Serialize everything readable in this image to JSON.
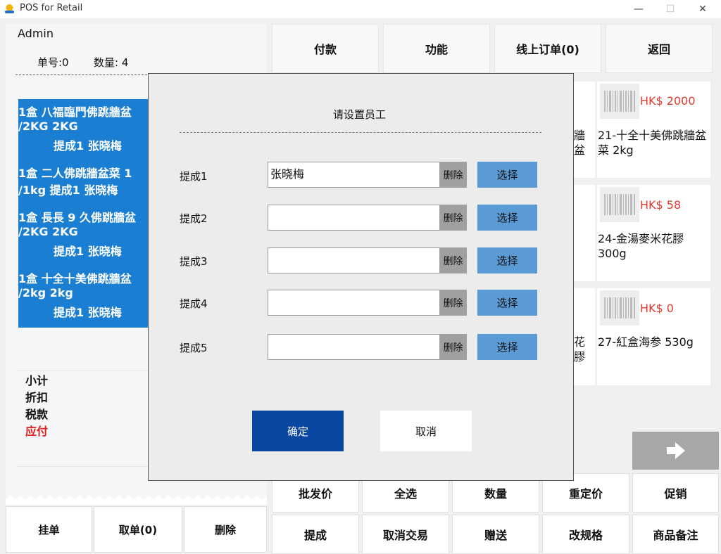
{
  "window": {
    "title": "POS for Retail",
    "minimize": "—",
    "maximize": "☐",
    "close": "✕"
  },
  "left": {
    "user": "Admin",
    "order_no": "单号:0",
    "quantity": "数量: 4",
    "items": [
      {
        "l1": "1盒    八福臨門佛跳牆盆",
        "l2": "/2KG  2KG",
        "l3": "提成1  张晓梅"
      },
      {
        "l1": "1盒    二人佛跳牆盆菜 1",
        "l2": "/1kg  提成1  张晓梅"
      },
      {
        "l1": "1盒    長長 9 久佛跳牆盆",
        "l2": "/2KG  2KG",
        "l3": "提成1  张晓梅"
      },
      {
        "l1": "1盒    十全十美佛跳牆盆",
        "l2": "/2kg  2kg",
        "l3": "提成1  张晓梅"
      }
    ],
    "summary": {
      "subtotal": "小计",
      "discount": "折扣",
      "tax": "税款",
      "payable": "应付"
    },
    "bottom_buttons": [
      "挂单",
      "取单(0)",
      "删除"
    ]
  },
  "top_buttons": [
    "付款",
    "功能",
    "线上订单(0)",
    "返回"
  ],
  "products": [
    {
      "price": "HK$ 2000",
      "name": "21-十全十美佛跳牆盆菜 2kg",
      "partial": "牆盆"
    },
    {
      "price": "HK$ 58",
      "name": "24-金湯麥米花膠 300g",
      "partial": ""
    },
    {
      "price": "HK$ 0",
      "name": "27-紅盒海参 530g",
      "partial": "花膠"
    }
  ],
  "action_buttons_row1": [
    "批发价",
    "全选",
    "数量",
    "重定价",
    "促销"
  ],
  "action_buttons_row2": [
    "提成",
    "取消交易",
    "赠送",
    "改规格",
    "商品备注"
  ],
  "modal": {
    "title": "请设置员工",
    "fields": [
      {
        "label": "提成1",
        "value": "张晓梅"
      },
      {
        "label": "提成2",
        "value": ""
      },
      {
        "label": "提成3",
        "value": ""
      },
      {
        "label": "提成4",
        "value": ""
      },
      {
        "label": "提成5",
        "value": ""
      }
    ],
    "delete_label": "删除",
    "select_label": "选择",
    "confirm": "确定",
    "cancel": "取消"
  },
  "colors": {
    "accent": "#1a7fd3",
    "price": "#e03a2f",
    "confirm": "#0a47a0",
    "select": "#5b9bd5",
    "payable": "#e02020"
  }
}
